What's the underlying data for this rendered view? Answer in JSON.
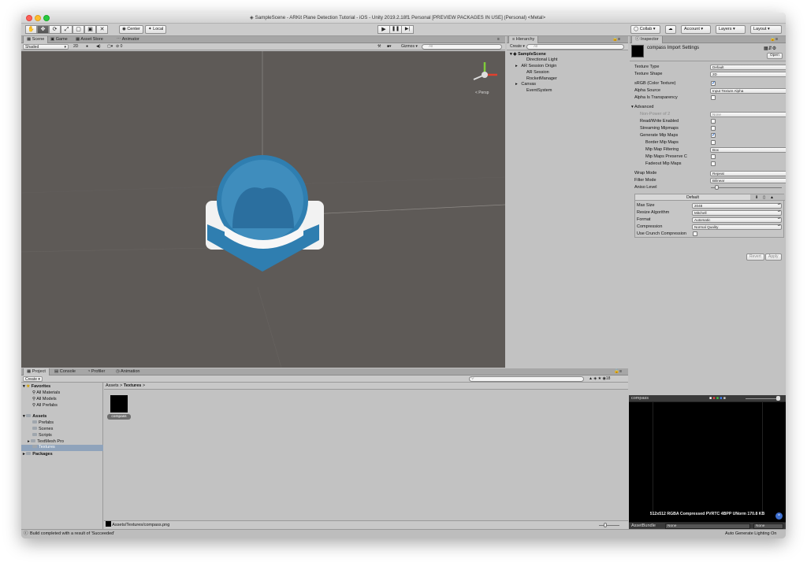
{
  "window": {
    "title": "SampleScene - ARKit Plane Detection Tutorial - iOS - Unity 2019.2.18f1 Personal [PREVIEW PACKAGES IN USE] (Personal) <Metal>"
  },
  "toolbar": {
    "center_label": "Center",
    "local_label": "Local",
    "collab_label": "Collab",
    "account_label": "Account",
    "layers_label": "Layers",
    "layout_label": "Layout"
  },
  "scene_panel": {
    "tabs": [
      "Scene",
      "Game",
      "Asset Store",
      "Animator"
    ],
    "shading": "Shaded",
    "mode_2d": "2D",
    "gizmos_label": "Gizmos",
    "search_placeholder": "All",
    "gizmo_label": "< Persp",
    "light_count": "0"
  },
  "hierarchy": {
    "tab": "Hierarchy",
    "create_label": "Create",
    "search_placeholder": "All",
    "scene_name": "SampleScene",
    "items": [
      "Directional Light",
      "AR Session Origin",
      "AR Session",
      "RocketManager",
      "Canvas",
      "EventSystem"
    ]
  },
  "inspector": {
    "tab": "Inspector",
    "header_title": "compass Import Settings",
    "open_label": "Open",
    "texture_type_label": "Texture Type",
    "texture_type_value": "Default",
    "texture_shape_label": "Texture Shape",
    "texture_shape_value": "2D",
    "srgb_label": "sRGB (Color Texture)",
    "alpha_source_label": "Alpha Source",
    "alpha_source_value": "Input Texture Alpha",
    "alpha_transparency_label": "Alpha Is Transparency",
    "advanced_label": "Advanced",
    "npot_label": "Non-Power of 2",
    "npot_value": "None",
    "readwrite_label": "Read/Write Enabled",
    "streaming_label": "Streaming Mipmaps",
    "genmip_label": "Generate Mip Maps",
    "border_mip_label": "Border Mip Maps",
    "mip_filter_label": "Mip Map Filtering",
    "mip_filter_value": "Box",
    "mip_preserve_label": "Mip Maps Preserve C",
    "fadeout_label": "Fadeout Mip Maps",
    "wrap_label": "Wrap Mode",
    "wrap_value": "Repeat",
    "filter_label": "Filter Mode",
    "filter_value": "Bilinear",
    "aniso_label": "Aniso Level",
    "aniso_value": "1",
    "platform_default": "Default",
    "maxsize_label": "Max Size",
    "maxsize_value": "2048",
    "resize_label": "Resize Algorithm",
    "resize_value": "Mitchell",
    "format_label": "Format",
    "format_value": "Automatic",
    "compression_label": "Compression",
    "compression_value": "Normal Quality",
    "crunch_label": "Use Crunch Compression",
    "revert_label": "Revert",
    "apply_label": "Apply"
  },
  "project": {
    "tabs": [
      "Project",
      "Console",
      "Profiler",
      "Animation"
    ],
    "create_label": "Create",
    "favorites_label": "Favorites",
    "favorites": [
      "All Materials",
      "All Models",
      "All Prefabs"
    ],
    "assets_label": "Assets",
    "folders": [
      "Prefabs",
      "Scenes",
      "Scripts",
      "TextMesh Pro",
      "Textures"
    ],
    "packages_label": "Packages",
    "breadcrumb_root": "Assets",
    "breadcrumb_sep": ">",
    "breadcrumb_current": "Textures",
    "asset_name": "compass",
    "path": "Assets/Textures/compass.png",
    "count": "18"
  },
  "preview": {
    "title": "compass",
    "info": "512x512  RGBA Compressed PVRTC 4BPP UNorm   170.8 KB",
    "assetbundle_label": "AssetBundle",
    "assetbundle_value": "None",
    "variant_value": "None"
  },
  "status": {
    "message": "Build completed with a result of 'Succeeded'",
    "right": "Auto Generate Lighting On"
  },
  "colors": {
    "scene_bg": "#5e5a57",
    "selection": "#3d80df",
    "compass_blue": "#2f7eb0"
  }
}
